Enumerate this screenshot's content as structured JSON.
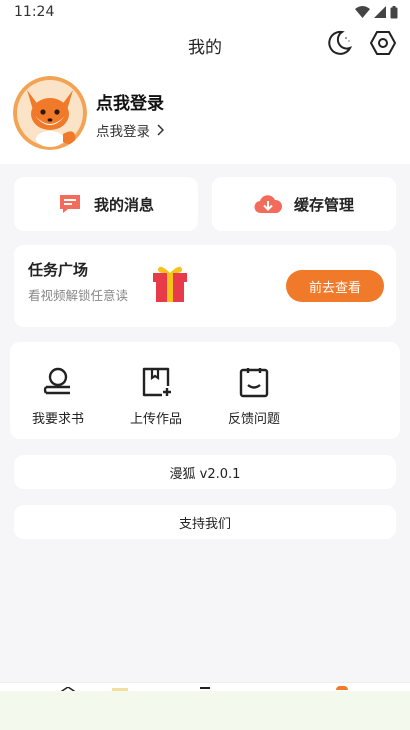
{
  "status_bar": {
    "time": "11:24"
  },
  "header": {
    "title": "我的"
  },
  "profile": {
    "login_title": "点我登录",
    "login_subtitle": "点我登录"
  },
  "quick_actions": [
    {
      "label": "我的消息",
      "icon": "message-icon"
    },
    {
      "label": "缓存管理",
      "icon": "cloud-download-icon"
    }
  ],
  "task_square": {
    "title": "任务广场",
    "subtitle": "看视频解锁任意读",
    "button_label": "前去查看",
    "icon": "gift-icon"
  },
  "tools": [
    {
      "label": "我要求书",
      "icon": "request-book-icon"
    },
    {
      "label": "上传作品",
      "icon": "upload-work-icon"
    },
    {
      "label": "反馈问题",
      "icon": "feedback-icon"
    }
  ],
  "version_text": "漫狐 v2.0.1",
  "support_text": "支持我们",
  "colors": {
    "accent": "#f07a2a",
    "background": "#f6f6f8",
    "card": "#ffffff"
  }
}
